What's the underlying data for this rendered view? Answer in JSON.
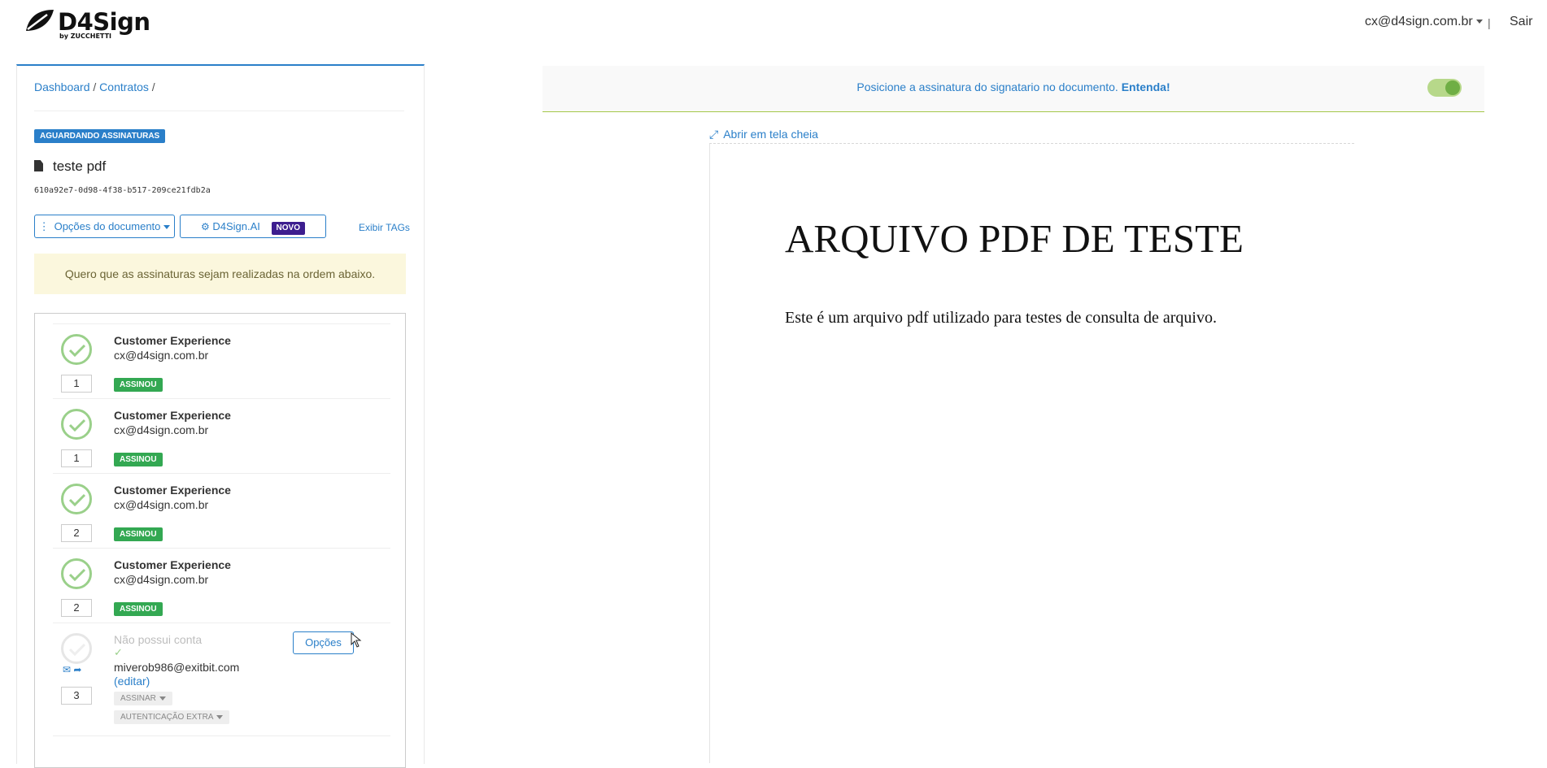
{
  "header": {
    "brand": "D4Sign",
    "brand_sub": "by ZUCCHETTI",
    "user_email": "cx@d4sign.com.br",
    "separator": "|",
    "logout_label": "Sair"
  },
  "breadcrumb": {
    "items": [
      "Dashboard",
      "Contratos"
    ],
    "separator": "/"
  },
  "document": {
    "status": "AGUARDANDO ASSINATURAS",
    "title": "teste pdf",
    "id": "610a92e7-0d98-4f38-b517-209ce21fdb2a"
  },
  "actions": {
    "options_label": "Opções do documento",
    "ai_label": "D4Sign.AI",
    "ai_badge": "NOVO",
    "show_tags_label": "Exibir TAGs"
  },
  "order_note": "Quero que as assinaturas sejam realizadas na ordem abaixo.",
  "signers": [
    {
      "name": "Customer Experience",
      "email": "cx@d4sign.com.br",
      "order": "1",
      "status": "ASSINOU"
    },
    {
      "name": "Customer Experience",
      "email": "cx@d4sign.com.br",
      "order": "1",
      "status": "ASSINOU"
    },
    {
      "name": "Customer Experience",
      "email": "cx@d4sign.com.br",
      "order": "2",
      "status": "ASSINOU"
    },
    {
      "name": "Customer Experience",
      "email": "cx@d4sign.com.br",
      "order": "2",
      "status": "ASSINOU"
    }
  ],
  "pending_signer": {
    "name": "Não possui conta",
    "email": "miverob986@exitbit.com",
    "edit_label": "(editar)",
    "order": "3",
    "action_label": "ASSINAR",
    "auth_label": "AUTENTICAÇÃO EXTRA",
    "options_label": "Opções"
  },
  "notice": {
    "text": "Posicione a assinatura do signatario no documento.",
    "link": "Entenda!"
  },
  "viewer": {
    "fullscreen_label": "Abrir em tela cheia",
    "pdf_title": "ARQUIVO PDF DE TESTE",
    "pdf_body": "Este é um arquivo pdf utilizado para testes de consulta de arquivo."
  },
  "colors": {
    "accent": "#2a7fc9",
    "success": "#33a852",
    "notice_bg": "#fbf7dd",
    "ai_badge": "#3d1e8f"
  }
}
